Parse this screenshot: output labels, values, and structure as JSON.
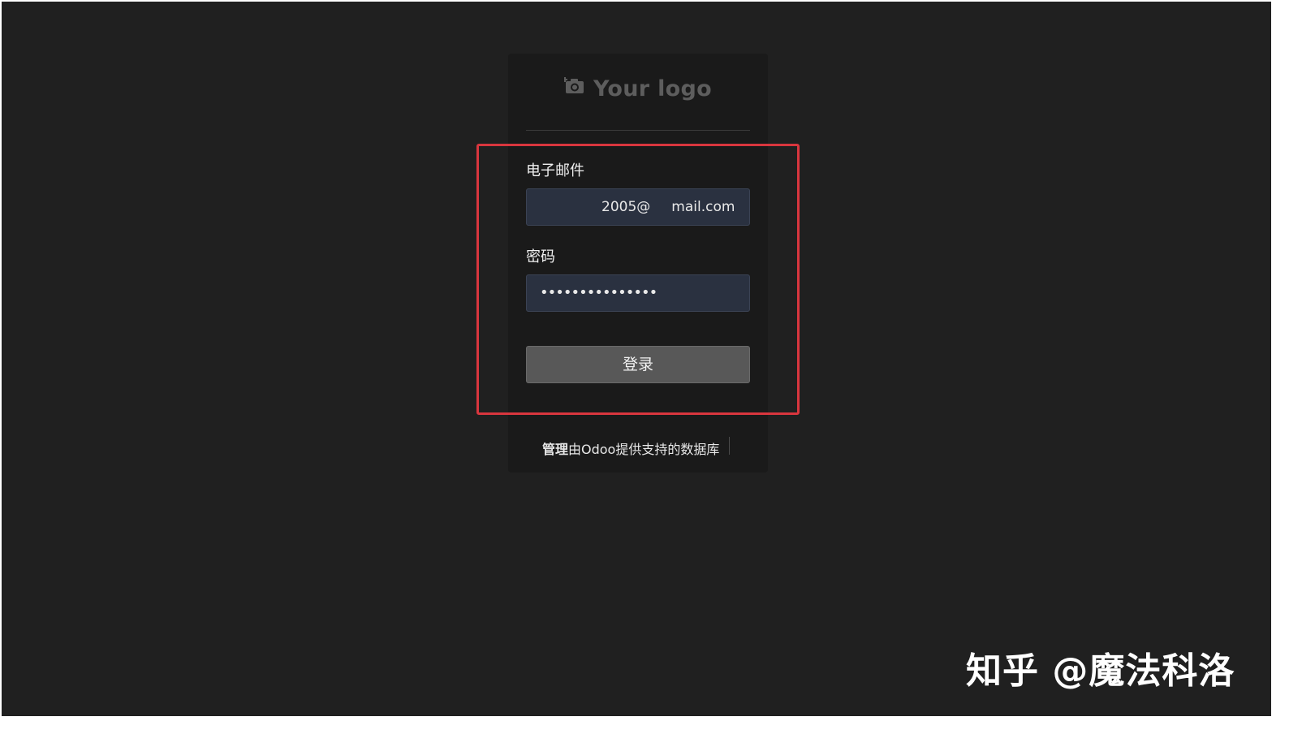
{
  "logo": {
    "text": "Your logo",
    "icon": "camera-icon"
  },
  "form": {
    "email_label": "电子邮件",
    "email_value_prefix": "2005@",
    "email_value_suffix": "mail.com",
    "password_label": "密码",
    "password_value": "•••••••••••••••",
    "login_label": "登录"
  },
  "footer": {
    "manage_label": "管理",
    "powered_text": "由Odoo提供支持的数据库"
  },
  "watermark": {
    "text": "知乎 @魔法科洛"
  },
  "colors": {
    "highlight": "#d9363e",
    "background": "#202020",
    "input_bg": "#2a3140"
  }
}
